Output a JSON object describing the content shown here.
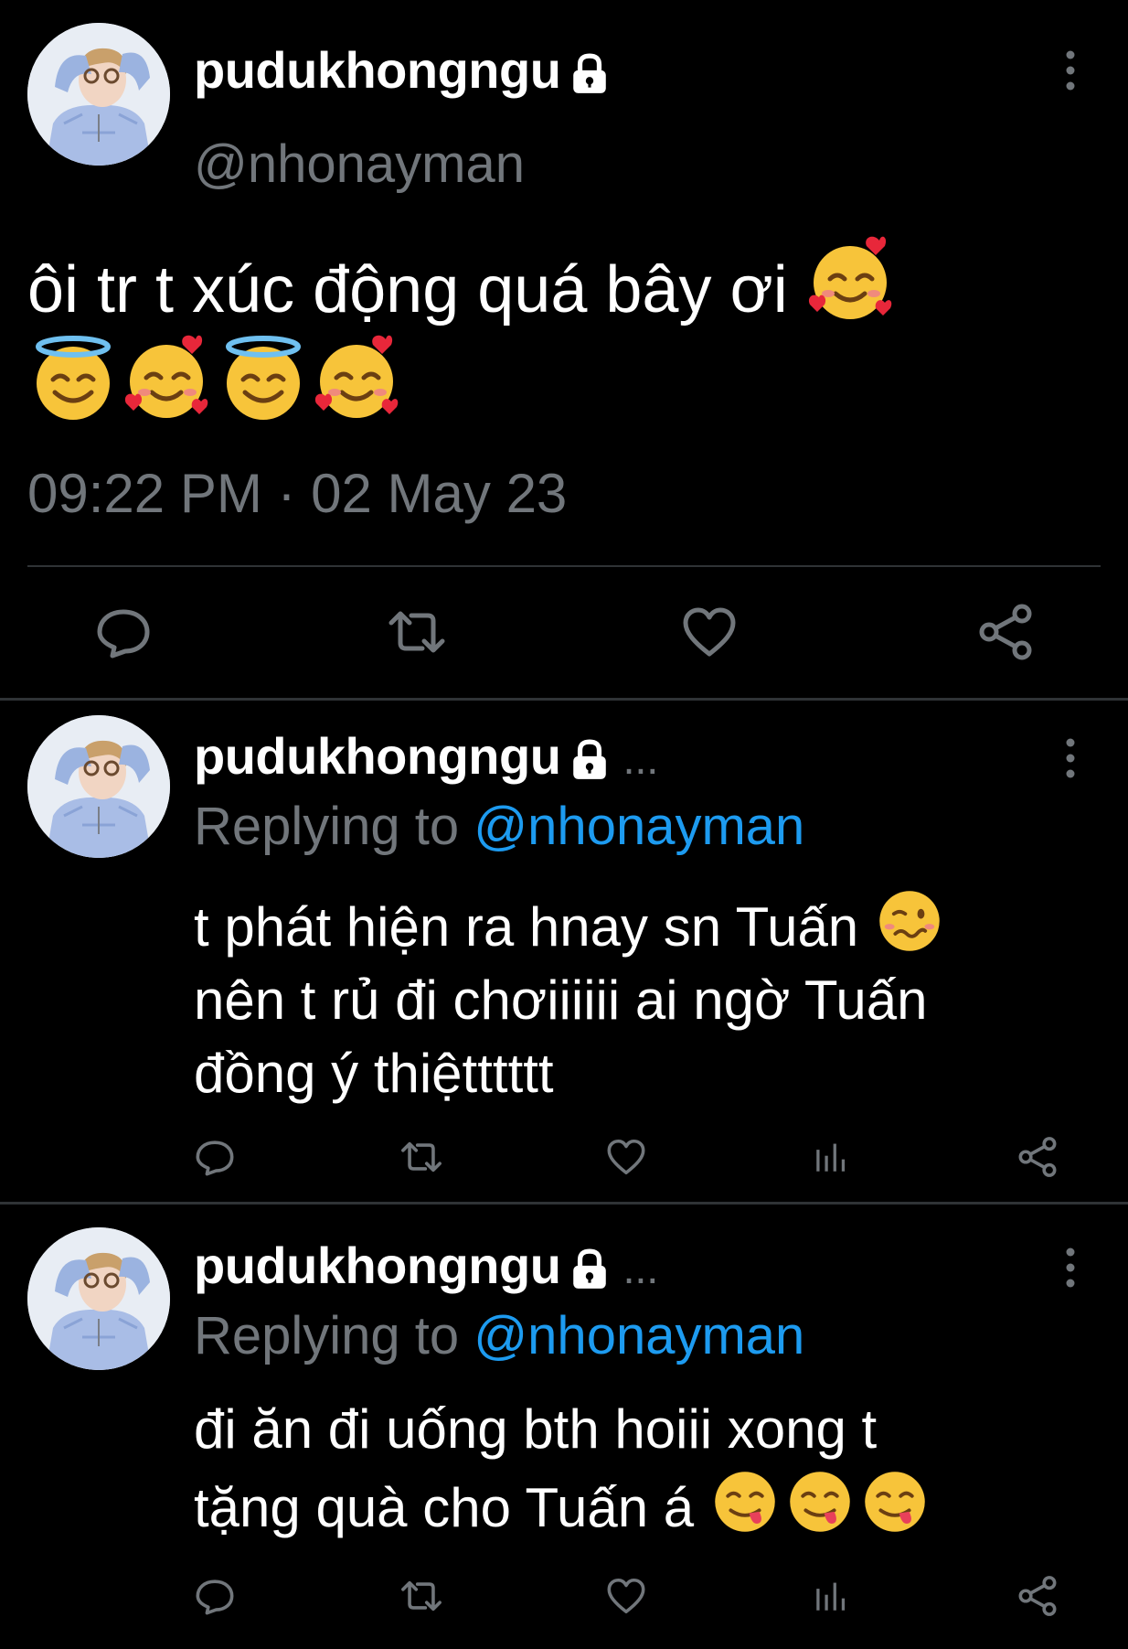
{
  "main_tweet": {
    "display_name": "pudukhongngu",
    "handle": "@nhonayman",
    "text": "ôi tr t xúc động quá bây ơi",
    "emojis": [
      "smiling-face-with-hearts",
      "smiling-face-with-halo",
      "smiling-face-with-hearts",
      "smiling-face-with-halo",
      "smiling-face-with-hearts"
    ],
    "timestamp": "09:22 PM · 02 May 23",
    "actions": [
      "reply-icon",
      "retweet-icon",
      "like-icon",
      "share-icon"
    ]
  },
  "replies": [
    {
      "display_name": "pudukhongngu",
      "ellipsis": "...",
      "replying_prefix": "Replying to",
      "replying_to": "@nhonayman",
      "line1": "t phát hiện ra hnay sn Tuấn",
      "line2": "nên t rủ đi chơiiiiii ai ngờ Tuấn",
      "line3": "đồng ý thiệtttttt",
      "emojis": [
        "woozy-face"
      ],
      "actions": [
        "reply-icon",
        "retweet-icon",
        "like-icon",
        "views-icon",
        "share-icon"
      ]
    },
    {
      "display_name": "pudukhongngu",
      "ellipsis": "...",
      "replying_prefix": "Replying to",
      "replying_to": "@nhonayman",
      "line1": "đi ăn đi uống bth hoiii xong t",
      "line2": "tặng quà cho Tuấn á",
      "emojis": [
        "face-savoring-food",
        "face-savoring-food",
        "face-savoring-food"
      ],
      "actions": [
        "reply-icon",
        "retweet-icon",
        "like-icon",
        "views-icon",
        "share-icon"
      ]
    }
  ],
  "colors": {
    "background": "#000000",
    "text": "#ffffff",
    "muted": "#71767b",
    "mention": "#1d9bf0",
    "divider": "#2f3336"
  }
}
